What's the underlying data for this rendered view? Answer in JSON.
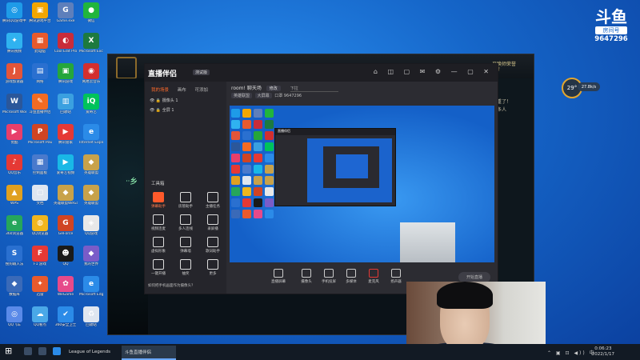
{
  "desktop": {
    "icons": [
      {
        "label": "腾讯QQ游戏中心",
        "glyph": "◎",
        "color": "#1e9be8"
      },
      {
        "label": "腾讯游戏平台",
        "glyph": "▣",
        "color": "#f3a600"
      },
      {
        "label": "Game.exe",
        "glyph": "G",
        "color": "#5e7fbb"
      },
      {
        "label": "微信",
        "glyph": "●",
        "color": "#21b53c"
      },
      {
        "label": "腾讯视频",
        "glyph": "✦",
        "color": "#2fb2f0"
      },
      {
        "label": "此电脑",
        "glyph": "▦",
        "color": "#e85a2d"
      },
      {
        "label": "Cool Edit Pro",
        "glyph": "◐",
        "color": "#c92c3a"
      },
      {
        "label": "Microsoft Excel",
        "glyph": "X",
        "color": "#1d7a3f"
      },
      {
        "label": "游戏加速器",
        "glyph": "J",
        "color": "#e2553a"
      },
      {
        "label": "网络",
        "glyph": "▤",
        "color": "#2a70d0"
      },
      {
        "label": "腾讯游戏",
        "glyph": "▣",
        "color": "#25a63b"
      },
      {
        "label": "网易云音乐",
        "glyph": "◉",
        "color": "#d32f2f"
      },
      {
        "label": "Microsoft Word",
        "glyph": "W",
        "color": "#2b579a"
      },
      {
        "label": "斗鱼直播伴侣",
        "glyph": "✎",
        "color": "#f36b22"
      },
      {
        "label": "回收站",
        "glyph": "▥",
        "color": "#3aa0e0"
      },
      {
        "label": "爱奇艺",
        "glyph": "iQ",
        "color": "#00c35b"
      },
      {
        "label": "优酷",
        "glyph": "▶",
        "color": "#e83f6a"
      },
      {
        "label": "Microsoft PowerPoint",
        "glyph": "P",
        "color": "#d04423"
      },
      {
        "label": "腾讯管家",
        "glyph": "▶",
        "color": "#e53935"
      },
      {
        "label": "Internet Explorer",
        "glyph": "e",
        "color": "#2b8be8"
      },
      {
        "label": "QQ音乐",
        "glyph": "♪",
        "color": "#e53935"
      },
      {
        "label": "控制面板",
        "glyph": "▦",
        "color": "#4a7acc"
      },
      {
        "label": "爱奇艺视频",
        "glyph": "▶",
        "color": "#19b8e6"
      },
      {
        "label": "英雄联盟",
        "glyph": "◆",
        "color": "#c8a24a"
      },
      {
        "label": "WPS",
        "glyph": "▲",
        "color": "#e0a020"
      },
      {
        "label": "文档",
        "glyph": "▢",
        "color": "#dfe6f0"
      },
      {
        "label": "英雄联盟WeGame",
        "glyph": "◆",
        "color": "#c8a24a"
      },
      {
        "label": "英雄联盟",
        "glyph": "◆",
        "color": "#c8a24a"
      },
      {
        "label": "360浏览器",
        "glyph": "e",
        "color": "#26a65b"
      },
      {
        "label": "QQ浏览器",
        "glyph": "◍",
        "color": "#f0b61e"
      },
      {
        "label": "GeForce",
        "glyph": "G",
        "color": "#d04423"
      },
      {
        "label": "QQ游戏",
        "glyph": "◈",
        "color": "#e8e8e8"
      },
      {
        "label": "搜狗输入法",
        "glyph": "S",
        "color": "#2a70d0"
      },
      {
        "label": "F1 游戏",
        "glyph": "F",
        "color": "#e53935"
      },
      {
        "label": "QQ",
        "glyph": "☻",
        "color": "#1a1a1a"
      },
      {
        "label": "我的世界",
        "glyph": "◆",
        "color": "#7a5cc8"
      },
      {
        "label": "数据库",
        "glyph": "◆",
        "color": "#3a6ab8"
      },
      {
        "label": "迅雷",
        "glyph": "✦",
        "color": "#e85a2d"
      },
      {
        "label": "WeGame",
        "glyph": "✿",
        "color": "#e64a8a"
      },
      {
        "label": "Microsoft Edge",
        "glyph": "e",
        "color": "#2b8be8"
      },
      {
        "label": "QQ飞车",
        "glyph": "◎",
        "color": "#5a8ae8"
      },
      {
        "label": "QQ看点",
        "glyph": "☁",
        "color": "#4aa8e8"
      },
      {
        "label": "360安全卫士",
        "glyph": "✔",
        "color": "#2b8be8"
      },
      {
        "label": "回收站",
        "glyph": "♻",
        "color": "#dfe6f0"
      }
    ]
  },
  "room_badge": {
    "logo": "斗鱼",
    "tag": "房间号",
    "number": "9647296"
  },
  "weather": {
    "temp": "29°",
    "pill": "27.8k/s"
  },
  "lol": {
    "player_name": "召唤师荣誉",
    "player_level": "荣誉",
    "right_lines": [
      "重了！",
      "多人"
    ],
    "dots": "ᐧᐧ乡"
  },
  "stream_app": {
    "brand": "直播伴侣",
    "version": "测试版",
    "title_icons": "⌂ ◫ ▢ ✉ ⚙ — ▢ ✕",
    "tabs": [
      "我的场景",
      "画布",
      "可添加"
    ],
    "scenes": [
      "摄像头 1",
      "全屏 1"
    ],
    "tools_title": "工具箱",
    "tools": [
      {
        "label": "弹幕助手",
        "hot": true
      },
      {
        "label": "房管助手",
        "hot": false
      },
      {
        "label": "主播任务",
        "hot": false
      },
      {
        "label": "视频连麦",
        "hot": false
      },
      {
        "label": "多人连线",
        "hot": false
      },
      {
        "label": "录屏播",
        "hot": false
      },
      {
        "label": "虚拟形象",
        "hot": false
      },
      {
        "label": "弹幕墙",
        "hot": false
      },
      {
        "label": "歌词助手",
        "hot": false
      },
      {
        "label": "一键开播",
        "hot": false
      },
      {
        "label": "抽奖",
        "hot": false
      },
      {
        "label": "更多",
        "hot": false
      }
    ],
    "hint": "如何把手机画面作为摄像头？",
    "room_title": "room! 聊天场",
    "room_chip": "修改",
    "room_field": "下拉",
    "meta_chips": [
      "英雄联盟",
      "大屏幕"
    ],
    "meta_text": "口罩 9647296",
    "bottom_buttons": [
      "直播屏幕",
      "摄像头",
      "手机投屏",
      "多媒体",
      "麦克风",
      "扬声器"
    ],
    "go_live": "开始直播",
    "preview_stats": "0 kb/s"
  },
  "taskbar": {
    "apps": [
      {
        "label": "League of Legends",
        "active": false
      },
      {
        "label": "斗鱼直播伴侣",
        "active": true
      }
    ],
    "time": "0:06:23",
    "date": "2022/1/17",
    "tray_icons": "⌃ ▣ ⊡ ◀)) 中"
  }
}
